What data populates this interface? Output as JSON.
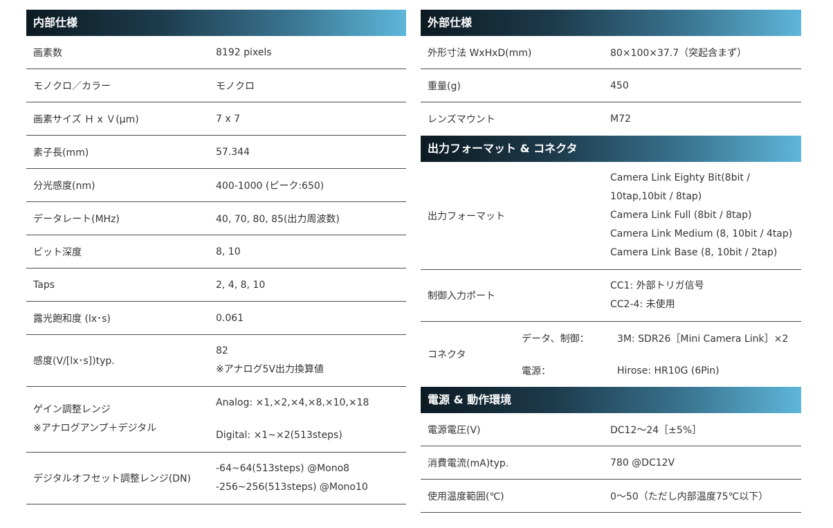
{
  "internal": {
    "title": "内部仕様",
    "rows": [
      {
        "label": "画素数",
        "value": [
          "8192 pixels"
        ]
      },
      {
        "label": "モノクロ／カラー",
        "value": [
          "モノクロ"
        ]
      },
      {
        "label": "画素サイズ Ｈ x Ｖ(μm)",
        "value": [
          "7 x 7"
        ]
      },
      {
        "label": "素子長(mm)",
        "value": [
          "57.344"
        ]
      },
      {
        "label": "分光感度(nm)",
        "value": [
          "400-1000 (ピーク:650)"
        ]
      },
      {
        "label": "データレート(MHz)",
        "value": [
          "40, 70, 80, 85(出力周波数)"
        ]
      },
      {
        "label": "ビット深度",
        "value": [
          "8, 10"
        ]
      },
      {
        "label": "Taps",
        "value": [
          "2, 4, 8, 10"
        ]
      },
      {
        "label": "露光飽和度 (lx･s)",
        "value": [
          "0.061"
        ]
      },
      {
        "label": "感度(V/[lx･s])typ.",
        "value": [
          "82",
          "※アナログ5V出力換算値"
        ]
      },
      {
        "label": [
          "ゲイン調整レンジ",
          "※アナログアンプ＋デジタル"
        ],
        "value": [
          "Analog: ×1,×2,×4,×8,×10,×18",
          "",
          "Digital: ×1~×2(513steps)"
        ]
      },
      {
        "label": "デジタルオフセット調整レンジ(DN)",
        "value": [
          "-64~64(513steps) @Mono8",
          "-256~256(513steps) @Mono10"
        ]
      }
    ]
  },
  "external": {
    "title": "外部仕様",
    "rows": [
      {
        "label": "外形寸法 WxHxD(mm)",
        "value": "80×100×37.7（突起含まず）"
      },
      {
        "label": "重量(g)",
        "value": "450"
      },
      {
        "label": "レンズマウント",
        "value": "M72"
      }
    ]
  },
  "output": {
    "title": "出力フォーマット & コネクタ",
    "format_label": "出力フォーマット",
    "format_values": [
      "Camera Link Eighty Bit(8bit /",
      "10tap,10bit / 8tap)",
      "Camera Link Full (8bit / 8tap)",
      "Camera Link Medium (8, 10bit / 4tap)",
      "Camera Link Base (8, 10bit / 2tap)"
    ],
    "control_label": "制御入力ポート",
    "control_values": [
      "CC1: 外部トリガ信号",
      "CC2-4: 未使用"
    ],
    "connector_label": "コネクタ",
    "connector_rows": [
      {
        "sub": "データ、制御：",
        "value": "3M: SDR26［Mini Camera Link］×2"
      },
      {
        "sub": "電源：",
        "value": "Hirose: HR10G (6Pin)"
      }
    ]
  },
  "power": {
    "title": "電源 & 動作環境",
    "rows": [
      {
        "label": "電源電圧(V)",
        "value": "DC12～24［±5%］"
      },
      {
        "label": "消費電流(mA)typ.",
        "value": "780 @DC12V"
      },
      {
        "label": "使用温度範囲(℃)",
        "value": "0～50（ただし内部温度75℃以下）"
      }
    ]
  }
}
